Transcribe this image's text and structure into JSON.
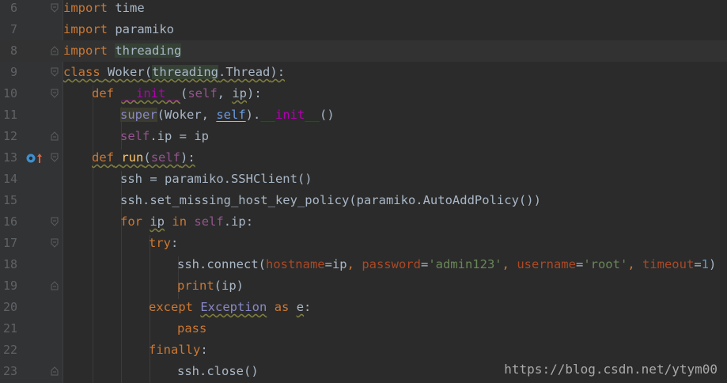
{
  "editor": {
    "lines": [
      {
        "num": "6"
      },
      {
        "num": "7"
      },
      {
        "num": "8"
      },
      {
        "num": "9"
      },
      {
        "num": "10"
      },
      {
        "num": "11"
      },
      {
        "num": "12"
      },
      {
        "num": "13"
      },
      {
        "num": "14"
      },
      {
        "num": "15"
      },
      {
        "num": "16"
      },
      {
        "num": "17"
      },
      {
        "num": "18"
      },
      {
        "num": "19"
      },
      {
        "num": "20"
      },
      {
        "num": "21"
      },
      {
        "num": "22"
      },
      {
        "num": "23"
      }
    ],
    "tokens": {
      "l6": [
        "import",
        " ",
        "time"
      ],
      "l7": [
        "import",
        " ",
        "paramiko"
      ],
      "l8": [
        "import",
        " ",
        "threading"
      ],
      "l9": [
        "class",
        " ",
        "Woker",
        "(",
        "threading",
        ".",
        "Thread",
        "):"
      ],
      "l10": [
        "def",
        " ",
        "__init__",
        "(",
        "self",
        ", ",
        "ip",
        "):"
      ],
      "l11": [
        "super",
        "(Woker, ",
        "self",
        ").",
        "__init__",
        "()"
      ],
      "l12": [
        "self",
        ".ip = ip"
      ],
      "l13": [
        "def",
        " ",
        "run",
        "(",
        "self",
        "):"
      ],
      "l14": [
        "ssh = paramiko.SSHClient()"
      ],
      "l15": [
        "ssh.set_missing_host_key_policy(paramiko.AutoAddPolicy())"
      ],
      "l16": [
        "for",
        " ",
        "ip",
        " ",
        "in",
        " ",
        "self",
        ".ip:"
      ],
      "l17": [
        "try",
        ":"
      ],
      "l18": [
        "ssh.connect(",
        "hostname",
        "=ip",
        ", ",
        "password",
        "=",
        "'admin123'",
        ", ",
        "username",
        "=",
        "'root'",
        ", ",
        "timeout",
        "=",
        "1",
        ")"
      ],
      "l19": [
        "print",
        "(ip)"
      ],
      "l20": [
        "except",
        " ",
        "Exception",
        " ",
        "as",
        " ",
        "e",
        ":"
      ],
      "l21": [
        "pass"
      ],
      "l22": [
        "finally",
        ":"
      ],
      "l23": [
        "ssh.close()"
      ]
    }
  },
  "colors": {
    "background": "#2b2b2b",
    "keyword": "#cc7832",
    "self": "#94558d",
    "string": "#6a8759",
    "function_def": "#ffc66d",
    "builtin": "#8888c6",
    "magic_method": "#b200b2",
    "keyword_argument": "#aa4926",
    "number": "#6897bb"
  },
  "gutter_icons": {
    "line13": [
      "override-method-icon",
      "up-arrow-icon"
    ]
  },
  "watermark": "https://blog.csdn.net/ytym00"
}
